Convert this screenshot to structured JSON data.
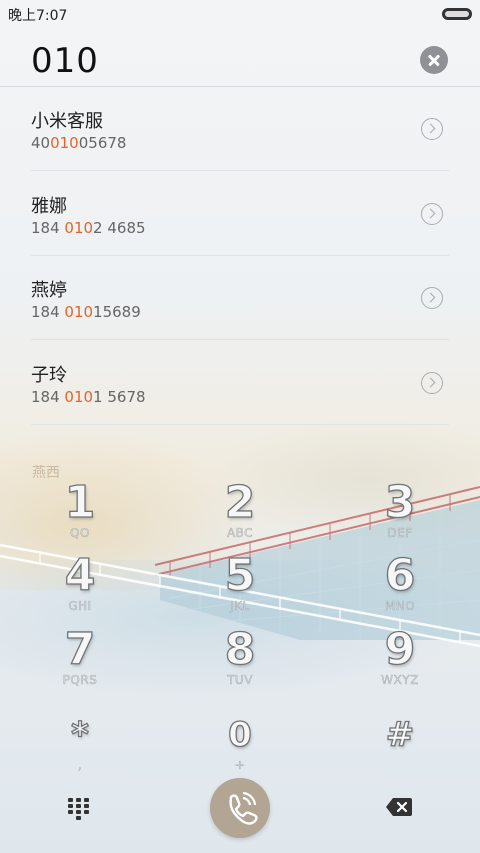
{
  "status": {
    "time": "晚上7:07"
  },
  "search": {
    "query": "010"
  },
  "contacts": [
    {
      "name": "小米客服",
      "number_pre": "40",
      "number_hl": "010",
      "number_post": "05678"
    },
    {
      "name": "雅娜",
      "number_pre": "184 ",
      "number_hl": "010",
      "number_post": "2 4685"
    },
    {
      "name": "燕婷",
      "number_pre": "184 ",
      "number_hl": "010",
      "number_post": "15689"
    },
    {
      "name": "子玲",
      "number_pre": "184 ",
      "number_hl": "010",
      "number_post": "1 5678"
    }
  ],
  "partial_item": "燕西",
  "keypad": [
    {
      "digit": "1",
      "letters": "QO"
    },
    {
      "digit": "2",
      "letters": "ABC"
    },
    {
      "digit": "3",
      "letters": "DEF"
    },
    {
      "digit": "4",
      "letters": "GHI"
    },
    {
      "digit": "5",
      "letters": "JKL"
    },
    {
      "digit": "6",
      "letters": "MNO"
    },
    {
      "digit": "7",
      "letters": "PQRS"
    },
    {
      "digit": "8",
      "letters": "TUV"
    },
    {
      "digit": "9",
      "letters": "WXYZ"
    },
    {
      "digit": "*",
      "letters": ","
    },
    {
      "digit": "0",
      "letters": "+"
    },
    {
      "digit": "#",
      "letters": ""
    }
  ],
  "icons": {
    "clear": "clear-icon",
    "chevron": "chevron-right-icon",
    "dialpad": "dialpad-icon",
    "call": "call-icon",
    "backspace": "backspace-icon"
  },
  "colors": {
    "highlight": "#e0662a",
    "call_button": "#b2a593"
  }
}
